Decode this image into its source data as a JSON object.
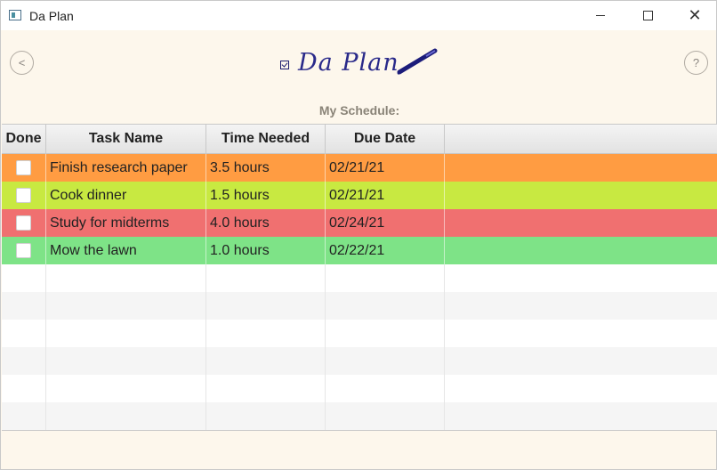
{
  "window": {
    "title": "Da Plan",
    "close_glyph": "✕"
  },
  "header": {
    "back_label": "<",
    "help_label": "?",
    "logo_text": "Da Plan",
    "subtitle": "My Schedule:"
  },
  "table": {
    "columns": [
      "Done",
      "Task Name",
      "Time Needed",
      "Due Date"
    ],
    "rows": [
      {
        "done": false,
        "name": "Finish research paper",
        "time": "3.5 hours",
        "due": "02/21/21",
        "color": "#ff9c42"
      },
      {
        "done": false,
        "name": "Cook dinner",
        "time": "1.5 hours",
        "due": "02/21/21",
        "color": "#c8e941"
      },
      {
        "done": false,
        "name": "Study for midterms",
        "time": "4.0 hours",
        "due": "02/24/21",
        "color": "#f07070"
      },
      {
        "done": false,
        "name": "Mow the lawn",
        "time": "1.0 hours",
        "due": "02/22/21",
        "color": "#7ee387"
      }
    ]
  },
  "colors": {
    "background": "#fdf7ec",
    "empty_row_alt": "#f5f5f5"
  },
  "icons": [
    "app-icon",
    "minimize-icon",
    "maximize-icon",
    "close-icon",
    "checkbox-icon",
    "pen-icon"
  ]
}
